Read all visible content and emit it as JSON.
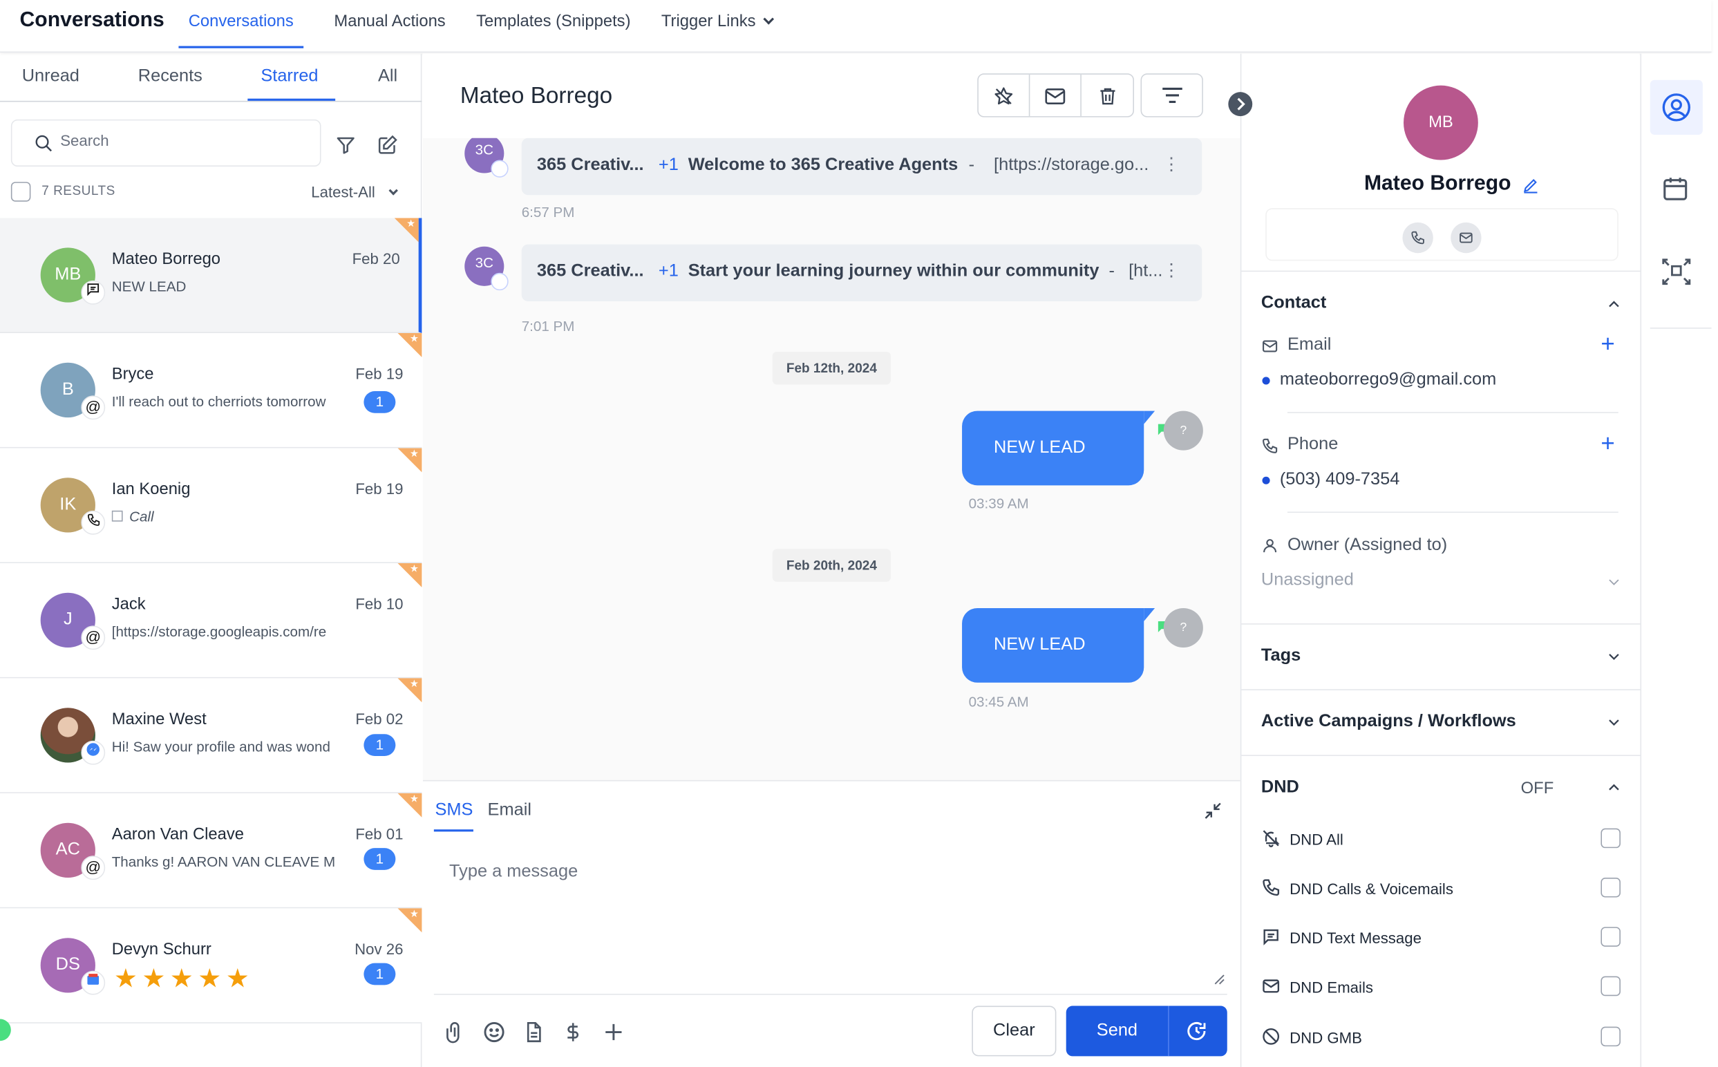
{
  "app": {
    "title": "Conversations"
  },
  "topnav": [
    {
      "label": "Conversations",
      "active": true
    },
    {
      "label": "Manual Actions"
    },
    {
      "label": "Templates (Snippets)"
    },
    {
      "label": "Trigger Links",
      "has_dropdown": true
    }
  ],
  "list": {
    "tabs": [
      "Unread",
      "Recents",
      "Starred",
      "All"
    ],
    "active_tab": "Starred",
    "search_placeholder": "Search",
    "results_label": "7 RESULTS",
    "sort_value": "Latest-All",
    "items": [
      {
        "initials": "MB",
        "name": "Mateo Borrego",
        "date": "Feb 20",
        "preview": "NEW LEAD",
        "avatar_color": "#7fbf6a",
        "channel_icon": "sms-icon",
        "selected": true
      },
      {
        "initials": "B",
        "name": "Bryce",
        "date": "Feb 19",
        "preview": "I'll reach out to cherriots tomorrow",
        "unread": "1",
        "avatar_color": "#7fa3bd",
        "channel_icon": "email-at-icon"
      },
      {
        "initials": "IK",
        "name": "Ian Koenig",
        "date": "Feb 19",
        "preview": "Call",
        "avatar_color": "#bfa36b",
        "channel_icon": "phone-icon"
      },
      {
        "initials": "J",
        "name": "Jack",
        "date": "Feb 10",
        "preview": "[https://storage.googleapis.com/re",
        "avatar_color": "#8a6fc0",
        "channel_icon": "email-at-icon"
      },
      {
        "initials": "",
        "name": "Maxine West",
        "date": "Feb 02",
        "preview": "Hi! Saw your profile and was wond",
        "unread": "1",
        "avatar_color": "#6b4a3a",
        "channel_icon": "messenger-icon"
      },
      {
        "initials": "AC",
        "name": "Aaron Van Cleave",
        "date": "Feb 01",
        "preview": "Thanks g! AARON VAN CLEAVE Ma",
        "unread": "1",
        "avatar_color": "#b96c98",
        "channel_icon": "email-at-icon"
      },
      {
        "initials": "DS",
        "name": "Devyn Schurr",
        "date": "Nov 26",
        "rating": 5,
        "unread": "1",
        "avatar_color": "#a66bb5",
        "channel_icon": "gmb-icon"
      }
    ]
  },
  "chat": {
    "contact_name": "Mateo Borrego",
    "messages": [
      {
        "avatar": "3C",
        "sender": "365 Creativ...",
        "plus": "+1",
        "subject": "Welcome to 365 Creative Agents",
        "sep": "-",
        "rest": "[https://storage.go...",
        "time": "6:57 PM"
      },
      {
        "avatar": "3C",
        "sender": "365 Creativ...",
        "plus": "+1",
        "subject": "Start your learning journey within our community",
        "sep": "-",
        "rest": "[ht...",
        "time": "7:01 PM"
      }
    ],
    "date1": "Feb 12th, 2024",
    "out1": {
      "text": "NEW LEAD",
      "time": "03:39 AM",
      "avatar": "?"
    },
    "date2": "Feb 20th, 2024",
    "out2": {
      "text": "NEW LEAD",
      "time": "03:45 AM",
      "avatar": "?"
    },
    "composer": {
      "tabs": [
        "SMS",
        "Email"
      ],
      "active_tab": "SMS",
      "placeholder": "Type a message",
      "clear_label": "Clear",
      "send_label": "Send"
    }
  },
  "contact": {
    "initials": "MB",
    "name": "Mateo Borrego",
    "section_contact": "Contact",
    "email_label": "Email",
    "email_value": "mateoborrego9@gmail.com",
    "phone_label": "Phone",
    "phone_value": "(503) 409-7354",
    "owner_label": "Owner (Assigned to)",
    "owner_value": "Unassigned",
    "tags_label": "Tags",
    "campaigns_label": "Active Campaigns / Workflows",
    "dnd_label": "DND",
    "dnd_state": "OFF",
    "dnd_items": [
      "DND All",
      "DND Calls & Voicemails",
      "DND Text Message",
      "DND Emails",
      "DND GMB"
    ]
  },
  "colors": {
    "accent": "#2563eb",
    "send": "#1d5ae0",
    "bubble": "#3b82f6",
    "star_corner": "#f6ad67"
  }
}
